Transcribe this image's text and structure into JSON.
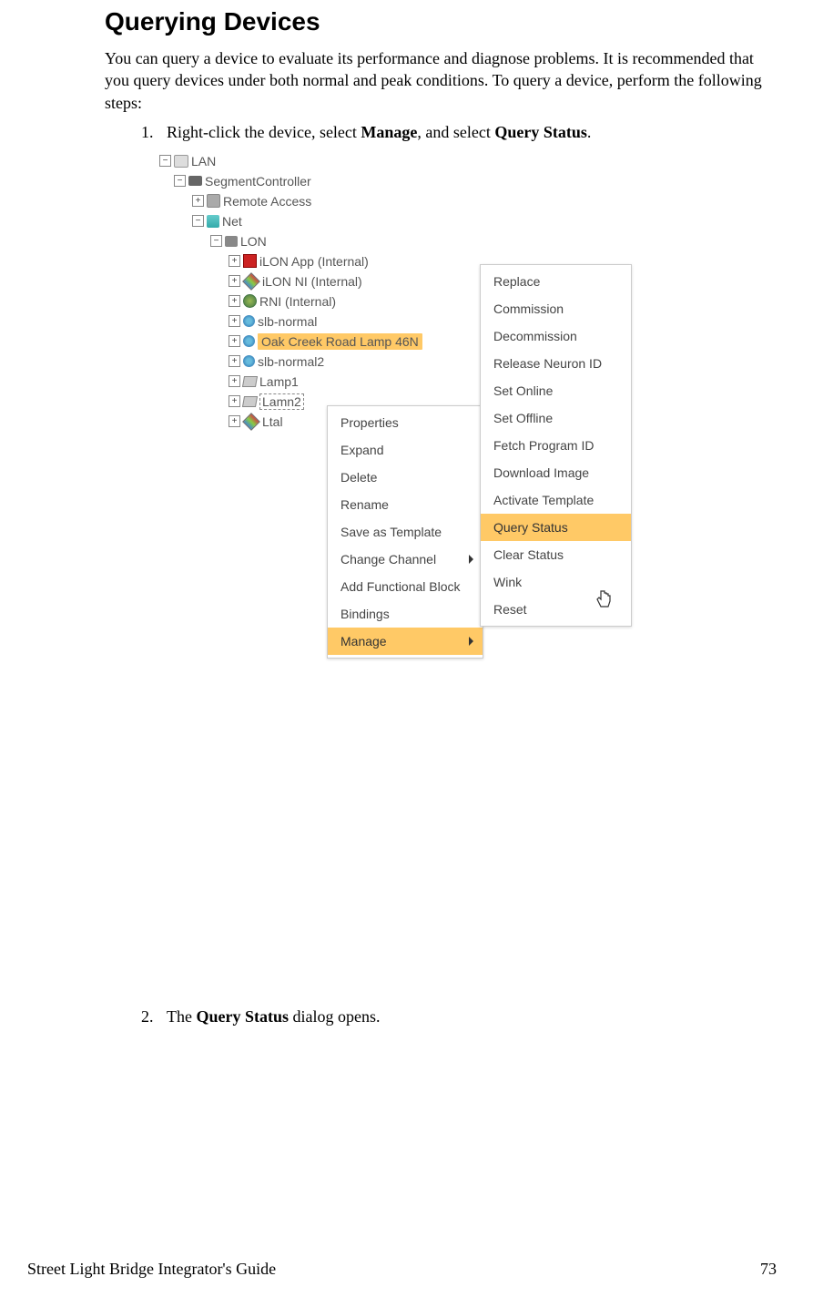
{
  "heading": "Querying Devices",
  "intro": "You can query a device to evaluate its performance and diagnose problems.  It is recommended that you query devices under both normal and peak conditions.  To query a device, perform the following steps:",
  "step1_pre": "Right-click the device, select ",
  "step1_b1": "Manage",
  "step1_mid": ", and select ",
  "step1_b2": "Query Status",
  "step1_post": ".",
  "step2_pre": "The ",
  "step2_b": "Query Status",
  "step2_post": " dialog opens.",
  "tree": {
    "lan": "LAN",
    "segment": "SegmentController",
    "remote": "Remote Access",
    "net": "Net",
    "lon": "LON",
    "ilon_app": "iLON App (Internal)",
    "ilon_ni": "iLON NI (Internal)",
    "rni": "RNI (Internal)",
    "slb_normal": "slb-normal",
    "oak_creek": "Oak Creek Road Lamp 46N",
    "slb_normal2": "slb-normal2",
    "lamp1": "Lamp1",
    "lamp2": "Lamn2",
    "ltal": "Ltal"
  },
  "menu1": {
    "properties": "Properties",
    "expand": "Expand",
    "delete": "Delete",
    "rename": "Rename",
    "save_template": "Save as Template",
    "change_channel": "Change Channel",
    "add_fb": "Add Functional Block",
    "bindings": "Bindings",
    "manage": "Manage"
  },
  "menu2": {
    "replace": "Replace",
    "commission": "Commission",
    "decommission": "Decommission",
    "release_nid": "Release Neuron ID",
    "set_online": "Set Online",
    "set_offline": "Set Offline",
    "fetch_pid": "Fetch Program ID",
    "download_image": "Download Image",
    "activate_template": "Activate Template",
    "query_status": "Query Status",
    "clear_status": "Clear Status",
    "wink": "Wink",
    "reset": "Reset"
  },
  "footer": {
    "title": "Street Light Bridge Integrator's Guide",
    "page": "73"
  }
}
